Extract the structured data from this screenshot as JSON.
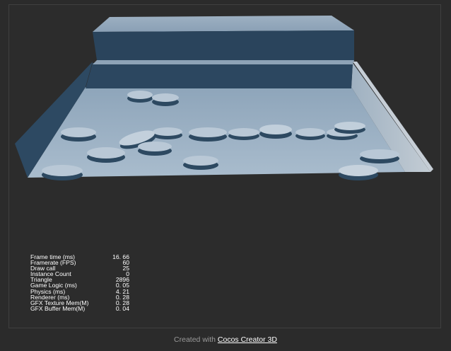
{
  "stats": [
    {
      "label": "Frame time (ms)",
      "value": "16. 66"
    },
    {
      "label": "Framerate (FPS)",
      "value": "60"
    },
    {
      "label": "Draw call",
      "value": "25"
    },
    {
      "label": "Instance Count",
      "value": "0"
    },
    {
      "label": "Triangle",
      "value": "2896"
    },
    {
      "label": "Game Logic (ms)",
      "value": "0. 05"
    },
    {
      "label": "Physics (ms)",
      "value": "4. 21"
    },
    {
      "label": "Renderer (ms)",
      "value": "0. 28"
    },
    {
      "label": "GFX Texture Mem(M)",
      "value": "0. 28"
    },
    {
      "label": "GFX Buffer Mem(M)",
      "value": "0. 04"
    }
  ],
  "footer": {
    "prefix": "Created with",
    "link_text": "Cocos Creator 3D"
  },
  "colors": {
    "background": "#2b2b2b",
    "floor": "#9fb3c5",
    "wall_dark": "#2c4760",
    "wall_light": "#b3bfc9",
    "disc_top": "#b9c8d6",
    "disc_side": "#2d4961"
  }
}
